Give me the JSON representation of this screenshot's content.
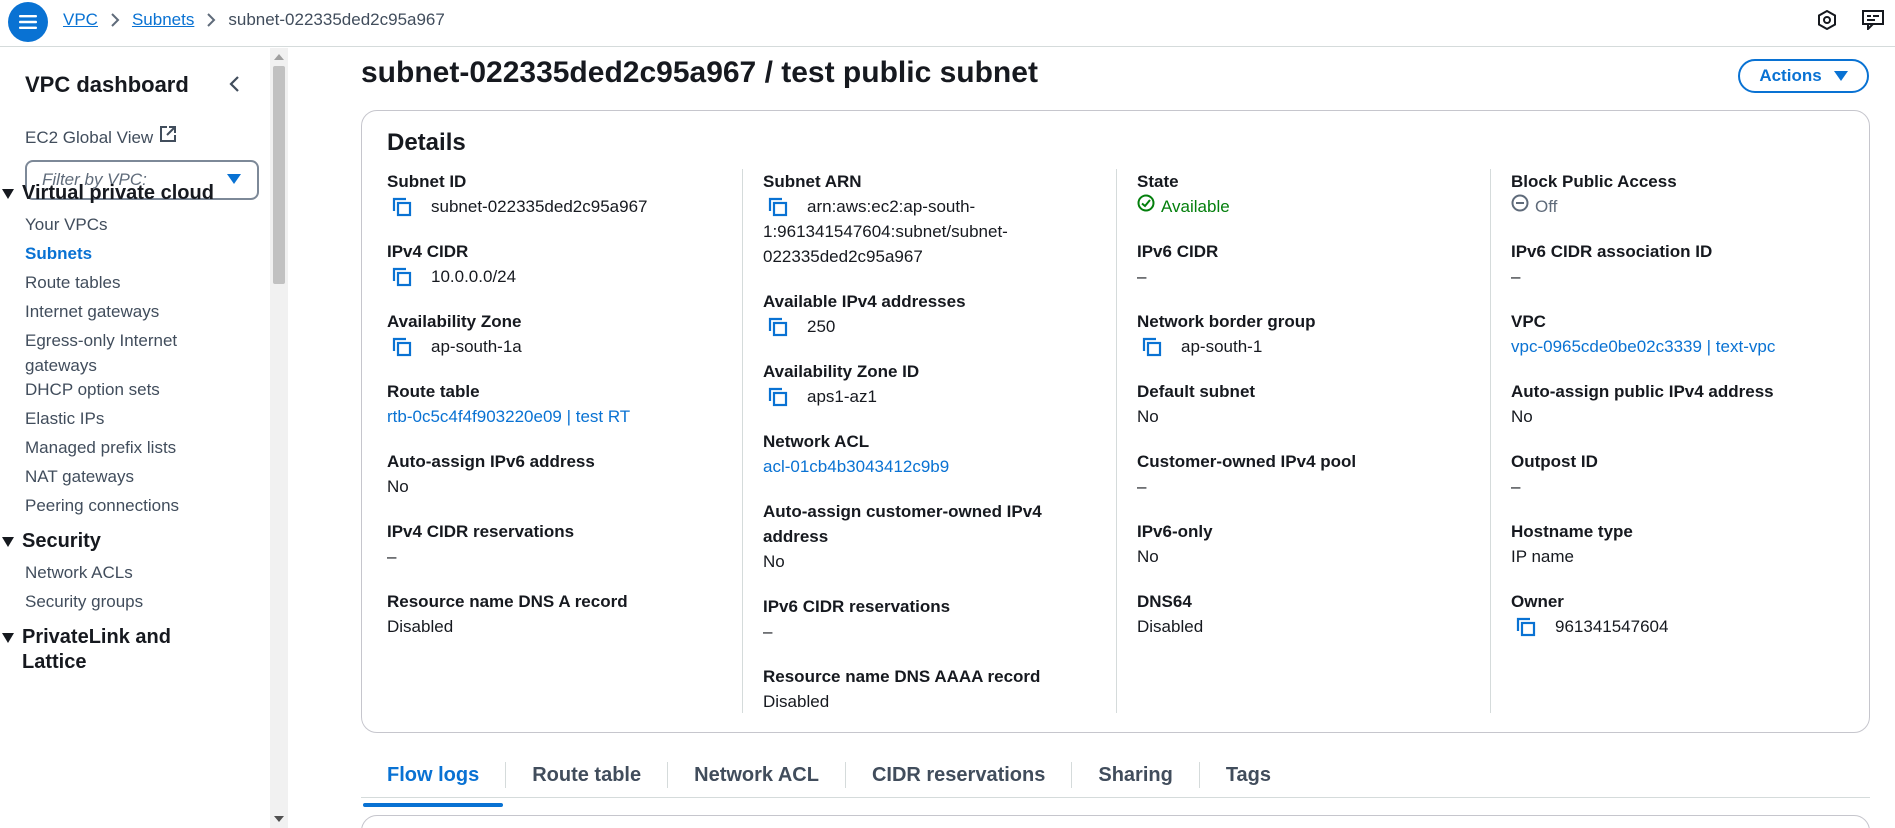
{
  "breadcrumb": {
    "vpc": "VPC",
    "subnets": "Subnets",
    "current": "subnet-022335ded2c95a967"
  },
  "sidebar": {
    "title": "VPC dashboard",
    "ec2_global_view": "EC2 Global View",
    "filter_placeholder": "Filter by VPC:",
    "section_vpc": "Virtual private cloud",
    "items_vpc": [
      "Your VPCs",
      "Subnets",
      "Route tables",
      "Internet gateways",
      "Egress-only Internet",
      "gateways",
      "DHCP option sets",
      "Elastic IPs",
      "Managed prefix lists",
      "NAT gateways",
      "Peering connections"
    ],
    "section_security": "Security",
    "items_security": [
      "Network ACLs",
      "Security groups"
    ],
    "section_privatelink_1": "PrivateLink and",
    "section_privatelink_2": "Lattice"
  },
  "page": {
    "title": "subnet-022335ded2c95a967 / test public subnet",
    "actions_label": "Actions"
  },
  "details": {
    "title": "Details",
    "subnet_id": {
      "label": "Subnet ID",
      "value": "subnet-022335ded2c95a967"
    },
    "ipv4_cidr": {
      "label": "IPv4 CIDR",
      "value": "10.0.0.0/24"
    },
    "availability_zone": {
      "label": "Availability Zone",
      "value": "ap-south-1a"
    },
    "route_table": {
      "label": "Route table",
      "value": "rtb-0c5c4f4f903220e09 | test RT"
    },
    "auto_assign_ipv6": {
      "label": "Auto-assign IPv6 address",
      "value": "No"
    },
    "ipv4_cidr_reservations": {
      "label": "IPv4 CIDR reservations",
      "value": "–"
    },
    "resource_dns_a": {
      "label": "Resource name DNS A record",
      "value": "Disabled"
    },
    "subnet_arn": {
      "label": "Subnet ARN",
      "line1": "arn:aws:ec2:ap-south-",
      "line2": "1:961341547604:subnet/subnet-",
      "line3": "022335ded2c95a967"
    },
    "available_ipv4": {
      "label": "Available IPv4 addresses",
      "value": "250"
    },
    "az_id": {
      "label": "Availability Zone ID",
      "value": "aps1-az1"
    },
    "network_acl": {
      "label": "Network ACL",
      "value": "acl-01cb4b3043412c9b9"
    },
    "auto_assign_customer_ipv4": {
      "label_line1": "Auto-assign customer-owned IPv4",
      "label_line2": "address",
      "value": "No"
    },
    "ipv6_cidr_reservations": {
      "label": "IPv6 CIDR reservations",
      "value": "–"
    },
    "resource_dns_aaaa": {
      "label": "Resource name DNS AAAA record",
      "value": "Disabled"
    },
    "state": {
      "label": "State",
      "value": "Available"
    },
    "ipv6_cidr": {
      "label": "IPv6 CIDR",
      "value": "–"
    },
    "network_border_group": {
      "label": "Network border group",
      "value": "ap-south-1"
    },
    "default_subnet": {
      "label": "Default subnet",
      "value": "No"
    },
    "customer_owned_pool": {
      "label": "Customer-owned IPv4 pool",
      "value": "–"
    },
    "ipv6_only": {
      "label": "IPv6-only",
      "value": "No"
    },
    "dns64": {
      "label": "DNS64",
      "value": "Disabled"
    },
    "block_public_access": {
      "label": "Block Public Access",
      "value": "Off"
    },
    "ipv6_cidr_assoc": {
      "label": "IPv6 CIDR association ID",
      "value": "–"
    },
    "vpc": {
      "label": "VPC",
      "value": "vpc-0965cde0be02c3339 | text-vpc"
    },
    "auto_assign_public_ipv4": {
      "label": "Auto-assign public IPv4 address",
      "value": "No"
    },
    "outpost_id": {
      "label": "Outpost ID",
      "value": "–"
    },
    "hostname_type": {
      "label": "Hostname type",
      "value": "IP name"
    },
    "owner": {
      "label": "Owner",
      "value": "961341547604"
    }
  },
  "tabs": [
    "Flow logs",
    "Route table",
    "Network ACL",
    "CIDR reservations",
    "Sharing",
    "Tags"
  ],
  "colors": {
    "accent": "#0972d3",
    "success": "#037f0c",
    "text": "#16191f",
    "muted": "#5f6b7a"
  },
  "icons": [
    "menu-icon",
    "chevron-right-icon",
    "settings-icon",
    "feedback-icon",
    "chevron-left-icon",
    "external-link-icon",
    "copy-icon",
    "status-check-icon",
    "status-off-icon"
  ]
}
